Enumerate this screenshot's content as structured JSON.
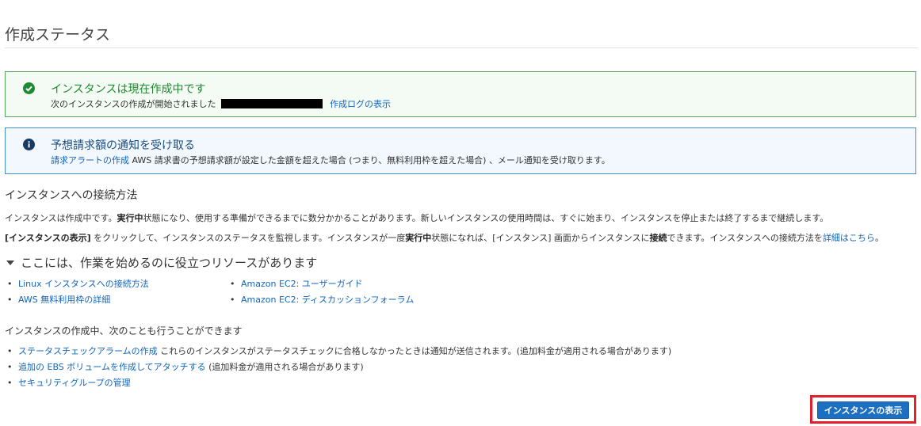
{
  "page": {
    "title": "作成ステータス"
  },
  "success_box": {
    "title": "インスタンスは現在作成中です",
    "line": "次のインスタンスの作成が開始されました",
    "log_link": "作成ログの表示",
    "icon": "check-circle-icon",
    "color": "#1d8a2e"
  },
  "info_box": {
    "title": "予想請求額の通知を受け取る",
    "link": "請求アラートの作成",
    "text": "AWS 請求書の予想請求額が設定した金額を超えた場合 (つまり、無料利用枠を超えた場合) 、メール通知を受け取ります。",
    "icon": "info-circle-icon",
    "color": "#1a4d80"
  },
  "connect": {
    "heading": "インスタンスへの接続方法",
    "p1_a": "インスタンスは作成中です。",
    "p1_b": "実行中",
    "p1_c": "状態になり、使用する準備ができるまでに数分かかることがあります。新しいインスタンスの使用時間は、すぐに始まり、インスタンスを停止または終了するまで継続します。",
    "p2_a": "[インスタンスの表示]",
    "p2_b": " をクリックして、インスタンスのステータスを監視します。インスタンスが一度",
    "p2_c": "実行中",
    "p2_d": "状態になれば、[インスタンス] 画面からインスタンスに",
    "p2_e": "接続",
    "p2_f": "できます。インスタンスへの接続方法を",
    "p2_link": "詳細はこちら",
    "p2_end": "。"
  },
  "resources": {
    "heading": "ここには、作業を始めるのに役立つリソースがあります",
    "left": [
      "Linux インスタンスへの接続方法",
      "AWS 無料利用枠の詳細"
    ],
    "right": [
      "Amazon EC2: ユーザーガイド",
      "Amazon EC2: ディスカッションフォーラム"
    ]
  },
  "also": {
    "heading": "インスタンスの作成中、次のことも行うことができます",
    "items": [
      {
        "link": "ステータスチェックアラームの作成",
        "text": " これらのインスタンスがステータスチェックに合格しなかったときは通知が送信されます。(追加料金が適用される場合があります)"
      },
      {
        "link": "追加の EBS ボリュームを作成してアタッチする",
        "text": " (追加料金が適用される場合があります)"
      },
      {
        "link": "セキュリティグループの管理",
        "text": ""
      }
    ]
  },
  "view_button": {
    "label": "インスタンスの表示",
    "color": "#1d6fc2",
    "highlight": "#e0202a"
  }
}
